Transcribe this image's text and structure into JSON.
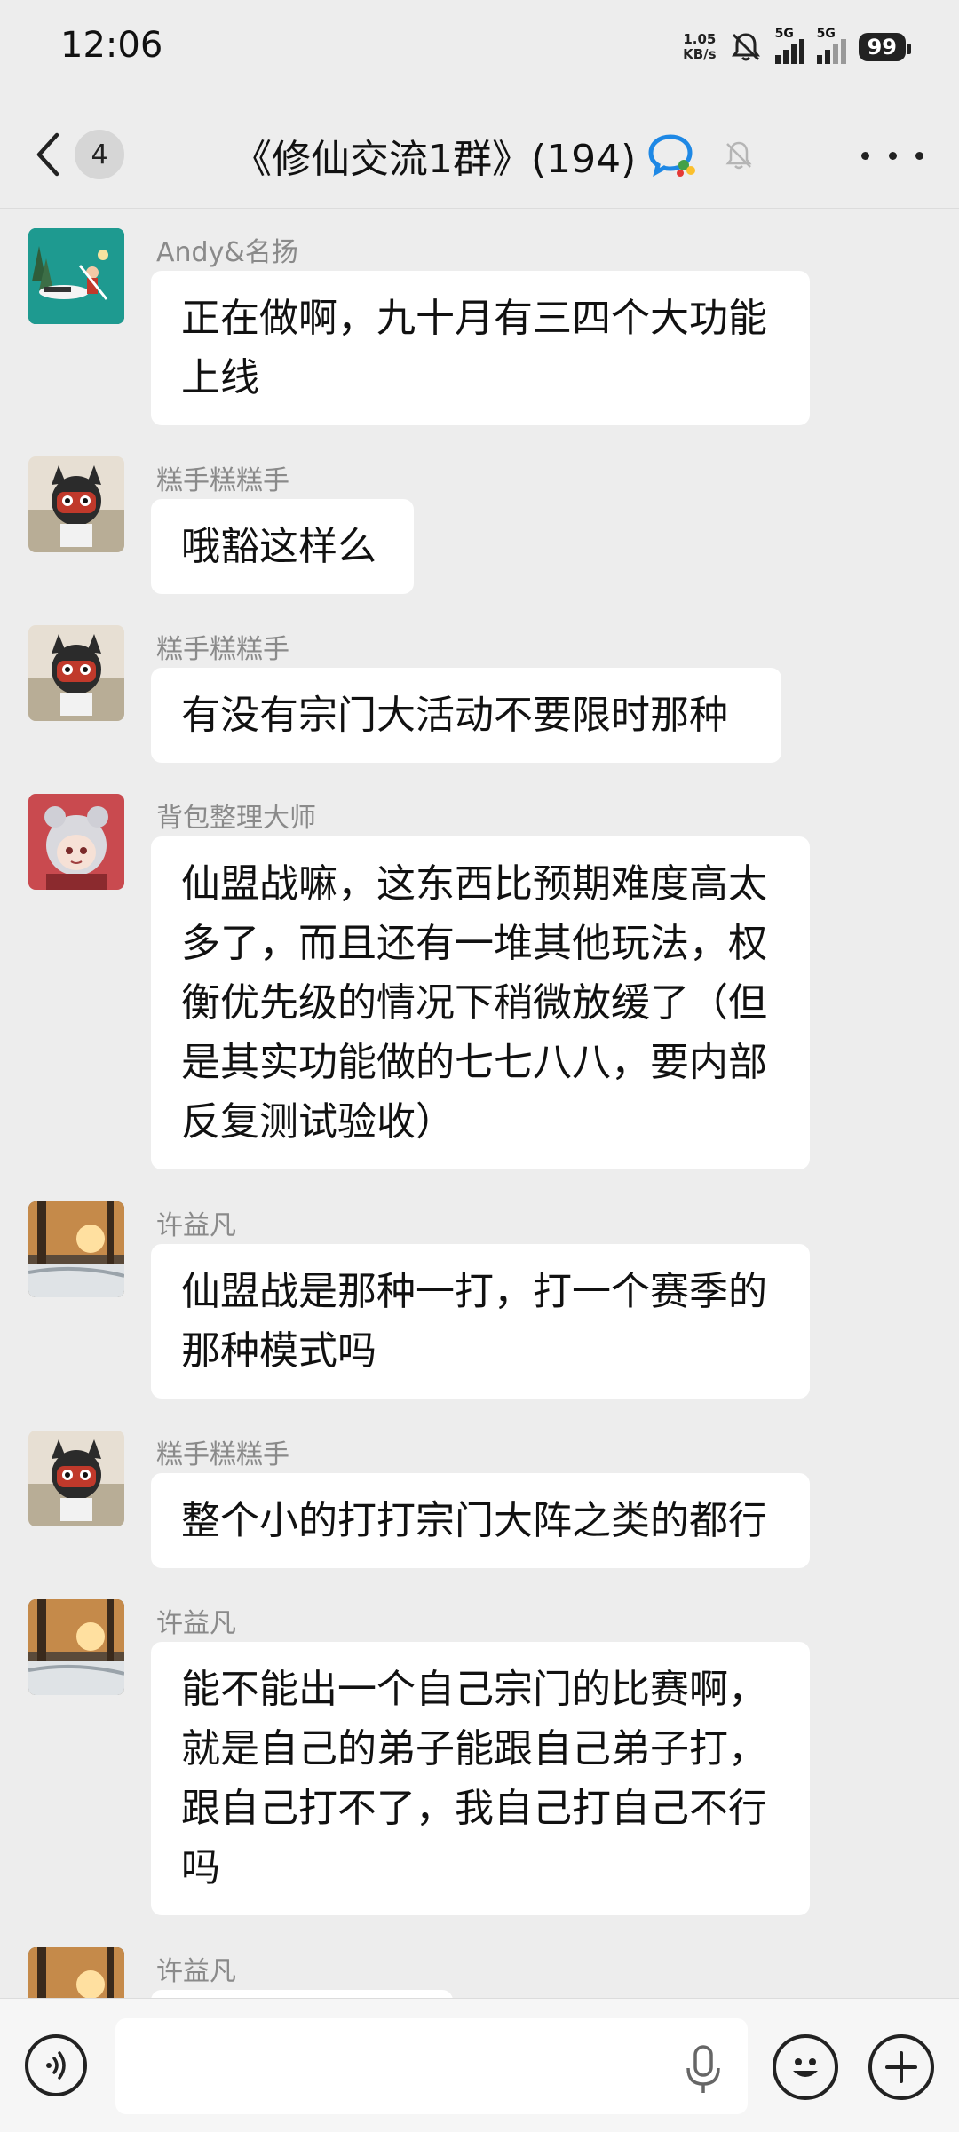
{
  "status_bar": {
    "time": "12:06",
    "net_speed_value": "1.05",
    "net_speed_unit": "KB/s",
    "sig1_label": "5G",
    "sig2_label": "5G",
    "battery": "99"
  },
  "header": {
    "back_count": "4",
    "title": "《修仙交流1群》(194)"
  },
  "messages": [
    {
      "sender": "Andy&名扬",
      "text": "正在做啊，九十月有三四个大功能上线"
    },
    {
      "sender": "糕手糕糕手",
      "text": "哦豁这样么"
    },
    {
      "sender": "糕手糕糕手",
      "text": "有没有宗门大活动不要限时那种"
    },
    {
      "sender": "背包整理大师",
      "text": "仙盟战嘛，这东西比预期难度高太多了，而且还有一堆其他玩法，权衡优先级的情况下稍微放缓了（但是其实功能做的七七八八，要内部反复测试验收）"
    },
    {
      "sender": "许益凡",
      "text": "仙盟战是那种一打，打一个赛季的那种模式吗"
    },
    {
      "sender": "糕手糕糕手",
      "text": "整个小的打打宗门大阵之类的都行"
    },
    {
      "sender": "许益凡",
      "text": "能不能出一个自己宗门的比赛啊，就是自己的弟子能跟自己弟子打，跟自己打不了，我自己打自己不行吗"
    },
    {
      "sender": "许益凡",
      "text": ""
    }
  ],
  "input": {
    "placeholder": ""
  },
  "colors": {
    "background": "#ededed",
    "bubble": "#ffffff",
    "sender_name": "#8a8a8a"
  },
  "icons": [
    "back-chevron-icon",
    "group-chat-icon",
    "mute-bell-icon",
    "more-dots-icon",
    "voice-icon",
    "mic-icon",
    "emoji-icon",
    "plus-icon"
  ]
}
